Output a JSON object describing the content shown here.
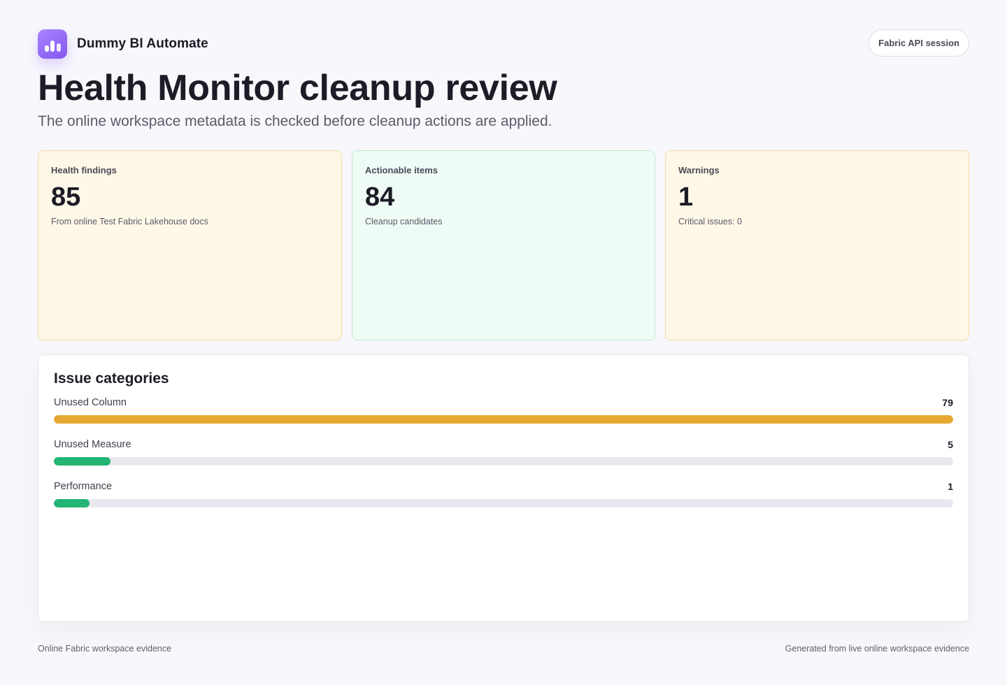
{
  "brand": {
    "name": "Dummy BI Automate",
    "logo_icon": "bar-chart-icon"
  },
  "session_pill": "Fabric API session",
  "page": {
    "title": "Health Monitor cleanup review",
    "subtitle": "The online workspace metadata is checked before cleanup actions are applied."
  },
  "stats": [
    {
      "label": "Health findings",
      "value": "85",
      "note": "From online Test Fabric Lakehouse docs",
      "tone": "amber"
    },
    {
      "label": "Actionable items",
      "value": "84",
      "note": "Cleanup candidates",
      "tone": "green"
    },
    {
      "label": "Warnings",
      "value": "1",
      "note": "Critical issues: 0",
      "tone": "amber"
    }
  ],
  "issues": {
    "title": "Issue categories",
    "items": [
      {
        "name": "Unused Column",
        "count": "79",
        "value": 79,
        "color": "#e5a832"
      },
      {
        "name": "Unused Measure",
        "count": "5",
        "value": 5,
        "color": "#22b573"
      },
      {
        "name": "Performance",
        "count": "1",
        "value": 1,
        "color": "#22b573"
      }
    ]
  },
  "colors": {
    "amber_bg": "#fff8e8",
    "green_bg": "#effcf5",
    "accent": "#8457f0"
  },
  "footer": {
    "left": "Online Fabric workspace evidence",
    "right": "Generated from live online workspace evidence"
  }
}
